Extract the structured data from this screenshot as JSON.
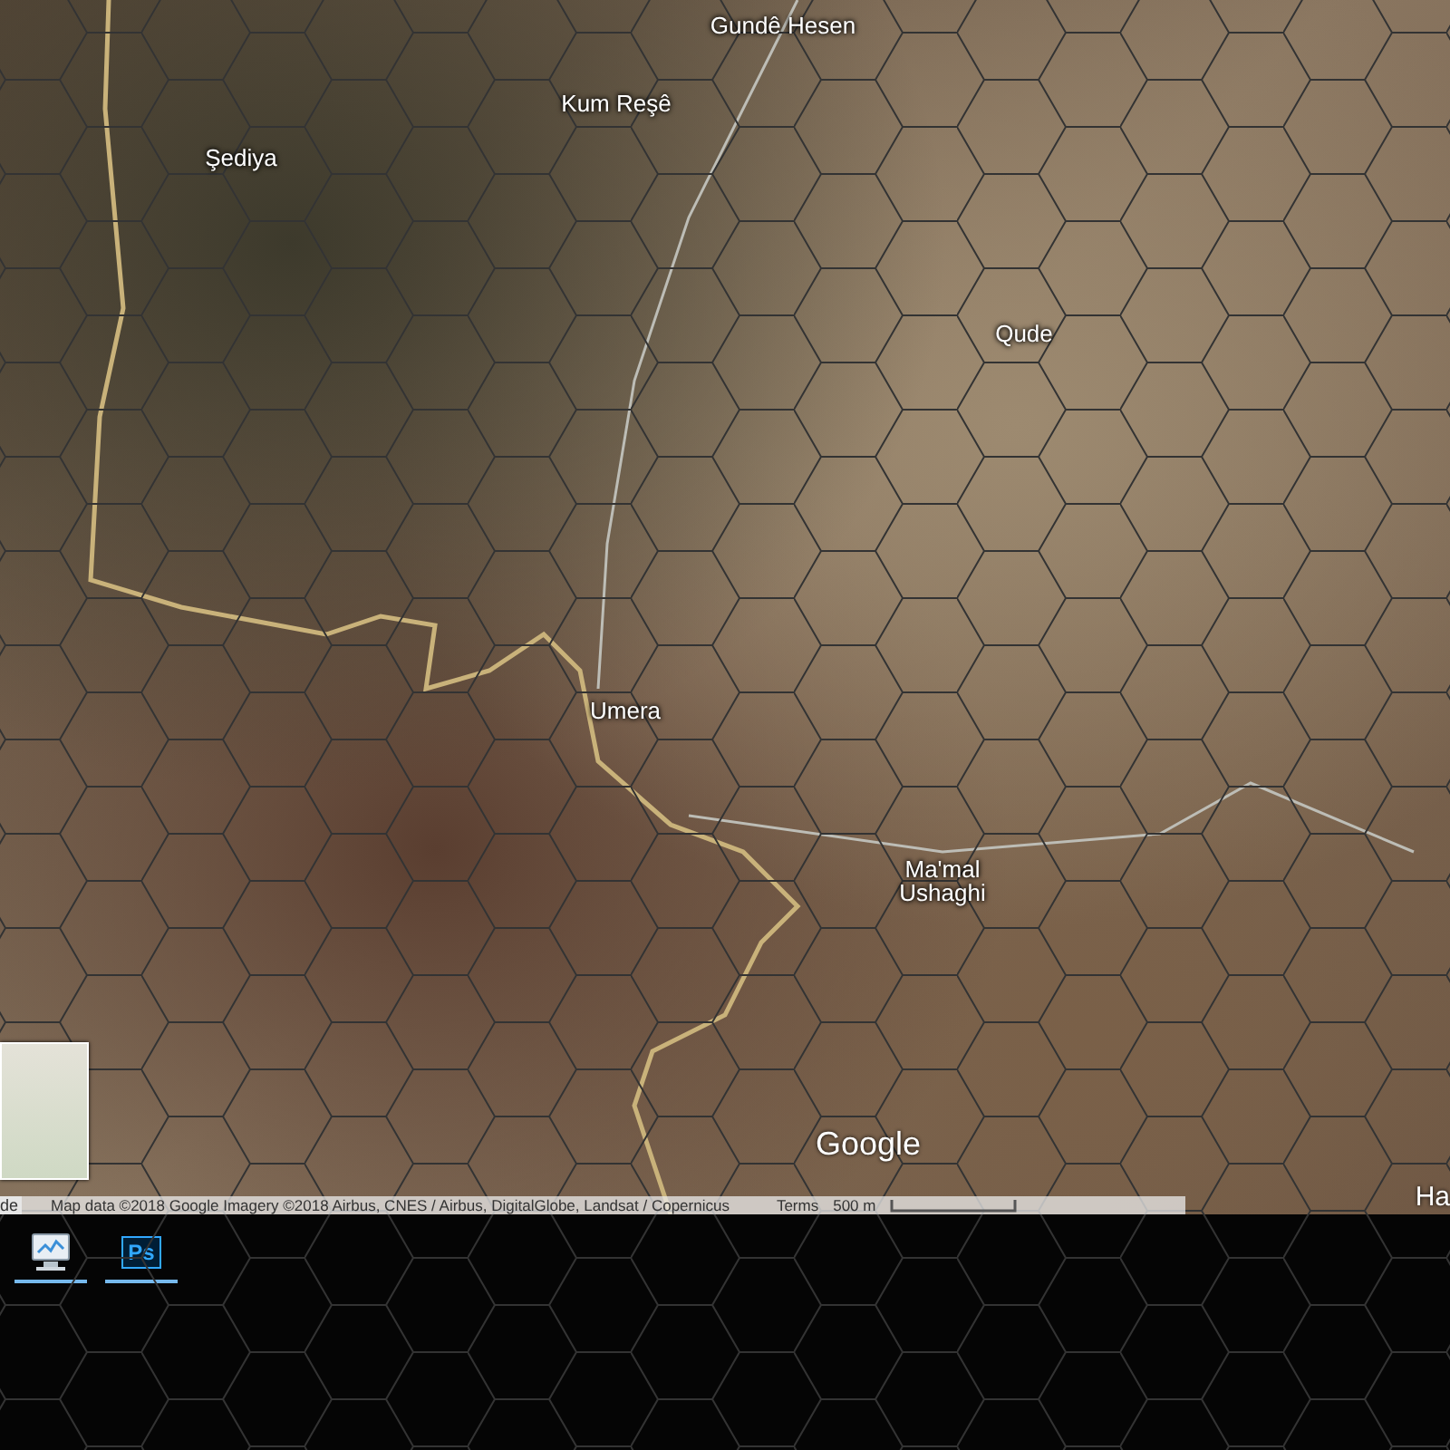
{
  "map": {
    "labels": [
      "Gundê Hesen",
      "Kum Reşê",
      "Şediya",
      "Qude",
      "Umera",
      "Ma'mal\nUshaghi"
    ],
    "edge_labels": [
      "de",
      "Ha"
    ],
    "logo": "Google",
    "attribution": "Map data ©2018 Google Imagery ©2018 Airbus, CNES / Airbus, DigitalGlobe, Landsat / Copernicus",
    "terms": "Terms",
    "scale": "500 m"
  },
  "taskbar": {
    "items": [
      {
        "kind": "monitor",
        "running": true
      },
      {
        "kind": "ps",
        "label": "Ps",
        "running": true
      }
    ]
  }
}
